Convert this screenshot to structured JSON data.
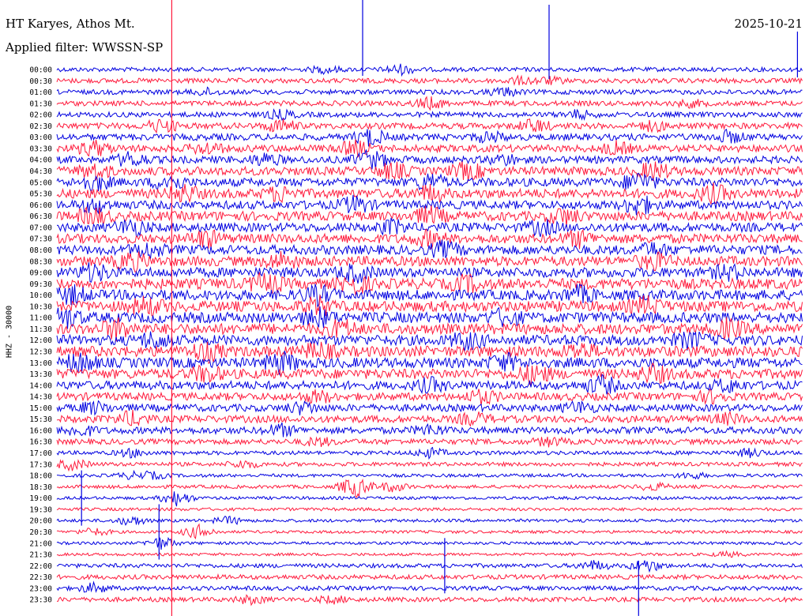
{
  "header": {
    "station": "HT Karyes, Athos Mt.",
    "filter": "Applied filter: WWSSN-SP",
    "date": "2025-10-21",
    "channel": "HHZ - 30000"
  },
  "colors": {
    "trace_a": "#0000e0",
    "trace_b": "#ff1a3c",
    "background": "#ffffff",
    "text": "#000000"
  },
  "chart_data": {
    "type": "helicorder",
    "title": "HT Karyes, Athos Mt.",
    "ylabel": "HHZ - 30000",
    "xlabel": "",
    "rows": [
      {
        "label": "00:00",
        "color": "blue",
        "noise": 0.22,
        "bursts": [
          [
            0.36,
            0.4
          ],
          [
            0.46,
            0.6
          ]
        ]
      },
      {
        "label": "00:30",
        "color": "red",
        "noise": 0.28,
        "bursts": [
          [
            0.62,
            0.4
          ],
          [
            0.66,
            0.4
          ]
        ]
      },
      {
        "label": "01:00",
        "color": "blue",
        "noise": 0.28,
        "bursts": [
          [
            0.2,
            0.4
          ],
          [
            0.6,
            0.5
          ]
        ]
      },
      {
        "label": "01:30",
        "color": "red",
        "noise": 0.3,
        "bursts": [
          [
            0.5,
            0.7
          ],
          [
            0.85,
            0.4
          ]
        ]
      },
      {
        "label": "02:00",
        "color": "blue",
        "noise": 0.32,
        "bursts": [
          [
            0.3,
            0.5
          ],
          [
            0.7,
            0.5
          ]
        ]
      },
      {
        "label": "02:30",
        "color": "red",
        "noise": 0.42,
        "bursts": [
          [
            0.14,
            0.8
          ],
          [
            0.3,
            0.8
          ],
          [
            0.64,
            0.8
          ],
          [
            0.8,
            0.6
          ]
        ]
      },
      {
        "label": "03:00",
        "color": "blue",
        "noise": 0.48,
        "bursts": [
          [
            0.42,
            1.0
          ],
          [
            0.58,
            0.6
          ],
          [
            0.9,
            0.7
          ]
        ]
      },
      {
        "label": "03:30",
        "color": "red",
        "noise": 0.55,
        "bursts": [
          [
            0.05,
            0.9
          ],
          [
            0.2,
            0.7
          ],
          [
            0.4,
            0.9
          ],
          [
            0.75,
            0.7
          ]
        ]
      },
      {
        "label": "04:00",
        "color": "blue",
        "noise": 0.55,
        "bursts": [
          [
            0.1,
            0.9
          ],
          [
            0.28,
            0.7
          ],
          [
            0.42,
            1.2
          ],
          [
            0.6,
            0.6
          ]
        ]
      },
      {
        "label": "04:30",
        "color": "red",
        "noise": 0.7,
        "bursts": [
          [
            0.05,
            0.9
          ],
          [
            0.45,
            0.9
          ],
          [
            0.55,
            1.0
          ],
          [
            0.8,
            1.0
          ]
        ]
      },
      {
        "label": "05:00",
        "color": "blue",
        "noise": 0.7,
        "bursts": [
          [
            0.05,
            1.0
          ],
          [
            0.15,
            1.0
          ],
          [
            0.5,
            1.0
          ],
          [
            0.78,
            1.2
          ]
        ]
      },
      {
        "label": "05:30",
        "color": "red",
        "noise": 0.8,
        "bursts": [
          [
            0.17,
            1.0
          ],
          [
            0.3,
            0.8
          ],
          [
            0.5,
            0.9
          ],
          [
            0.88,
            1.0
          ]
        ]
      },
      {
        "label": "06:00",
        "color": "blue",
        "noise": 0.7,
        "bursts": [
          [
            0.05,
            0.8
          ],
          [
            0.4,
            1.0
          ],
          [
            0.78,
            1.2
          ]
        ]
      },
      {
        "label": "06:30",
        "color": "red",
        "noise": 0.8,
        "bursts": [
          [
            0.05,
            1.0
          ],
          [
            0.5,
            1.0
          ],
          [
            0.68,
            1.0
          ]
        ]
      },
      {
        "label": "07:00",
        "color": "blue",
        "noise": 0.75,
        "bursts": [
          [
            0.1,
            1.0
          ],
          [
            0.45,
            0.8
          ],
          [
            0.65,
            0.8
          ]
        ]
      },
      {
        "label": "07:30",
        "color": "red",
        "noise": 0.8,
        "bursts": [
          [
            0.2,
            1.0
          ],
          [
            0.5,
            0.9
          ],
          [
            0.7,
            0.9
          ]
        ]
      },
      {
        "label": "08:00",
        "color": "blue",
        "noise": 0.8,
        "bursts": [
          [
            0.12,
            0.9
          ],
          [
            0.52,
            0.9
          ],
          [
            0.8,
            0.7
          ]
        ]
      },
      {
        "label": "08:30",
        "color": "red",
        "noise": 0.85,
        "bursts": [
          [
            0.1,
            1.0
          ],
          [
            0.3,
            0.9
          ],
          [
            0.8,
            0.9
          ]
        ]
      },
      {
        "label": "09:00",
        "color": "blue",
        "noise": 0.85,
        "bursts": [
          [
            0.05,
            1.0
          ],
          [
            0.4,
            1.0
          ],
          [
            0.9,
            0.8
          ]
        ]
      },
      {
        "label": "09:30",
        "color": "red",
        "noise": 0.95,
        "bursts": [
          [
            0.28,
            1.2
          ],
          [
            0.4,
            1.0
          ],
          [
            0.55,
            0.9
          ]
        ]
      },
      {
        "label": "10:00",
        "color": "blue",
        "noise": 0.9,
        "bursts": [
          [
            0.02,
            1.0
          ],
          [
            0.35,
            1.0
          ],
          [
            0.7,
            0.9
          ]
        ]
      },
      {
        "label": "10:30",
        "color": "red",
        "noise": 0.95,
        "bursts": [
          [
            0.12,
            1.0
          ],
          [
            0.35,
            1.0
          ],
          [
            0.79,
            1.0
          ]
        ]
      },
      {
        "label": "11:00",
        "color": "blue",
        "noise": 0.95,
        "bursts": [
          [
            0.01,
            1.2
          ],
          [
            0.35,
            1.0
          ],
          [
            0.6,
            0.9
          ]
        ]
      },
      {
        "label": "11:30",
        "color": "red",
        "noise": 0.95,
        "bursts": [
          [
            0.08,
            1.2
          ],
          [
            0.38,
            1.0
          ],
          [
            0.9,
            1.0
          ]
        ]
      },
      {
        "label": "12:00",
        "color": "blue",
        "noise": 0.9,
        "bursts": [
          [
            0.13,
            0.9
          ],
          [
            0.55,
            1.0
          ],
          [
            0.85,
            0.9
          ]
        ]
      },
      {
        "label": "12:30",
        "color": "red",
        "noise": 0.95,
        "bursts": [
          [
            0.2,
            1.1
          ],
          [
            0.35,
            0.9
          ],
          [
            0.7,
            0.9
          ]
        ]
      },
      {
        "label": "13:00",
        "color": "blue",
        "noise": 0.9,
        "bursts": [
          [
            0.03,
            1.1
          ],
          [
            0.3,
            1.2
          ],
          [
            0.6,
            0.9
          ]
        ]
      },
      {
        "label": "13:30",
        "color": "red",
        "noise": 0.85,
        "bursts": [
          [
            0.2,
            0.9
          ],
          [
            0.64,
            1.1
          ],
          [
            0.8,
            1.0
          ]
        ]
      },
      {
        "label": "14:00",
        "color": "blue",
        "noise": 0.7,
        "bursts": [
          [
            0.5,
            0.8
          ],
          [
            0.73,
            1.1
          ],
          [
            0.9,
            0.7
          ]
        ]
      },
      {
        "label": "14:30",
        "color": "red",
        "noise": 0.6,
        "bursts": [
          [
            0.35,
            0.7
          ],
          [
            0.57,
            0.8
          ],
          [
            0.88,
            0.7
          ]
        ]
      },
      {
        "label": "15:00",
        "color": "blue",
        "noise": 0.55,
        "bursts": [
          [
            0.05,
            0.7
          ],
          [
            0.33,
            0.7
          ],
          [
            0.7,
            0.7
          ]
        ]
      },
      {
        "label": "15:30",
        "color": "red",
        "noise": 0.55,
        "bursts": [
          [
            0.1,
            0.9
          ],
          [
            0.56,
            0.7
          ],
          [
            0.9,
            0.6
          ]
        ]
      },
      {
        "label": "16:00",
        "color": "blue",
        "noise": 0.5,
        "bursts": [
          [
            0.03,
            0.7
          ],
          [
            0.3,
            0.7
          ],
          [
            0.5,
            0.6
          ]
        ]
      },
      {
        "label": "16:30",
        "color": "red",
        "noise": 0.35,
        "bursts": [
          [
            0.35,
            0.5
          ],
          [
            0.66,
            0.5
          ]
        ]
      },
      {
        "label": "17:00",
        "color": "blue",
        "noise": 0.18,
        "bursts": [
          [
            0.1,
            0.5
          ],
          [
            0.5,
            0.6
          ],
          [
            0.93,
            0.5
          ]
        ]
      },
      {
        "label": "17:30",
        "color": "red",
        "noise": 0.18,
        "bursts": [
          [
            0.02,
            0.7
          ],
          [
            0.25,
            0.5
          ]
        ]
      },
      {
        "label": "18:00",
        "color": "blue",
        "noise": 0.1,
        "bursts": [
          [
            0.1,
            0.4
          ],
          [
            0.13,
            0.4
          ],
          [
            0.85,
            0.4
          ]
        ]
      },
      {
        "label": "18:30",
        "color": "red",
        "noise": 0.12,
        "bursts": [
          [
            0.4,
            1.4
          ],
          [
            0.45,
            0.6
          ],
          [
            0.8,
            0.5
          ]
        ]
      },
      {
        "label": "19:00",
        "color": "blue",
        "noise": 0.08,
        "bursts": [
          [
            0.16,
            1.0
          ]
        ]
      },
      {
        "label": "19:30",
        "color": "red",
        "noise": 0.08,
        "bursts": []
      },
      {
        "label": "20:00",
        "color": "blue",
        "noise": 0.08,
        "bursts": [
          [
            0.1,
            0.6
          ],
          [
            0.23,
            0.5
          ]
        ]
      },
      {
        "label": "20:30",
        "color": "red",
        "noise": 0.06,
        "bursts": [
          [
            0.05,
            0.5
          ],
          [
            0.19,
            0.9
          ]
        ]
      },
      {
        "label": "21:00",
        "color": "blue",
        "noise": 0.06,
        "bursts": [
          [
            0.14,
            0.8
          ]
        ]
      },
      {
        "label": "21:30",
        "color": "red",
        "noise": 0.05,
        "bursts": [
          [
            0.9,
            0.3
          ]
        ]
      },
      {
        "label": "22:00",
        "color": "blue",
        "noise": 0.2,
        "bursts": [
          [
            0.72,
            0.6
          ],
          [
            0.79,
            0.8
          ]
        ]
      },
      {
        "label": "22:30",
        "color": "red",
        "noise": 0.25,
        "bursts": []
      },
      {
        "label": "23:00",
        "color": "blue",
        "noise": 0.22,
        "bursts": [
          [
            0.05,
            0.6
          ]
        ]
      },
      {
        "label": "23:30",
        "color": "red",
        "noise": 0.25,
        "bursts": [
          [
            0.26,
            0.5
          ],
          [
            0.37,
            0.4
          ]
        ]
      }
    ],
    "spikes": [
      {
        "row": 0,
        "x": 0.41
      },
      {
        "row": 0,
        "x": 0.66
      },
      {
        "row": 0,
        "x": 0.993
      },
      {
        "row": 0,
        "x": 0.154
      },
      {
        "row": 41,
        "x": 0.137
      },
      {
        "row": 44,
        "x": 0.52
      },
      {
        "row": 46,
        "x": 0.78
      },
      {
        "row": 38,
        "x": 0.033
      }
    ],
    "grid": false,
    "legend": "none"
  }
}
